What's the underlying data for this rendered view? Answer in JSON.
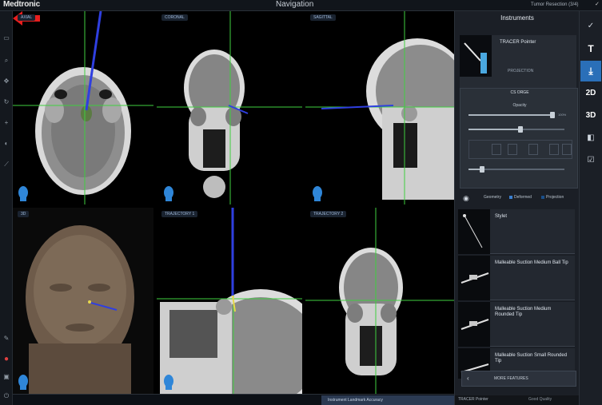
{
  "brand": "Medtronic",
  "app_title": "Navigation",
  "status": "Tumor Resection (3/4)",
  "viewports": [
    {
      "label": "AXIAL"
    },
    {
      "label": "CORONAL"
    },
    {
      "label": "SAGITTAL"
    },
    {
      "label": "3D"
    },
    {
      "label": "TRAJECTORY 1"
    },
    {
      "label": "TRAJECTORY 2"
    }
  ],
  "panel": {
    "title": "Instruments",
    "tool_name": "TRACER Pointer",
    "projection": "PROJECTION",
    "cs_title": "CS ORGE",
    "opacity_label": "Opacity",
    "opacity_value": "100%",
    "eye_options": [
      "Geometry",
      "Deformed",
      "Projection"
    ],
    "list": [
      {
        "label": "Stylet"
      },
      {
        "label": "Malleable Suction Medium Ball Tip"
      },
      {
        "label": "Malleable Suction Medium Rounded Tip"
      },
      {
        "label": "Malleable Suction Small Rounded Tip"
      }
    ],
    "more_button": "MORE FEATURES",
    "footer_left": "TRACER Pointer",
    "footer_right": "Good Quality"
  },
  "rightbar": [
    {
      "label": "✓",
      "icon": "check-pen-icon"
    },
    {
      "label": "T",
      "icon": "text-icon"
    },
    {
      "label": "⤓",
      "icon": "instrument-icon",
      "active": true
    },
    {
      "label": "2D",
      "icon": "2d-icon"
    },
    {
      "label": "3D",
      "icon": "3d-icon"
    },
    {
      "label": "◧",
      "icon": "layout-icon"
    },
    {
      "label": "☑",
      "icon": "checklist-icon"
    }
  ],
  "bottom_info": "Instrument Landmark Accuracy",
  "colors": {
    "accent": "#2a6fb8",
    "crosshair": "#3fcf3f",
    "trajectory": "#2f3fe0",
    "marker": "#e81e1e"
  }
}
